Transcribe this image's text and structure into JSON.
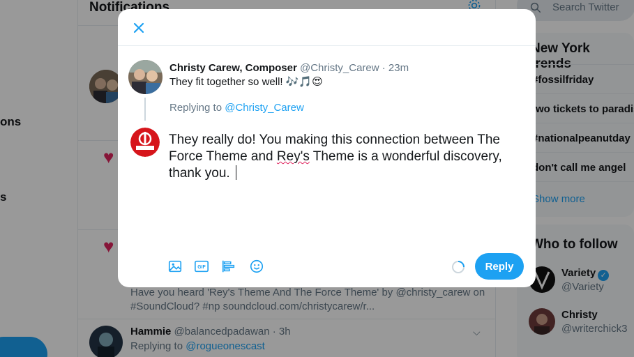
{
  "background": {
    "left_nav": {
      "items": [
        "ons",
        "s"
      ]
    },
    "center": {
      "title": "Notifications",
      "snippet_line1": "Have you heard 'Rey's Theme And The Force Theme' by @christy_carew on",
      "snippet_line2": "#SoundCloud? #np soundcloud.com/christycarew/r...",
      "tweet": {
        "name": "Hammie",
        "handle": "@balancedpadawan",
        "time": "· 3h",
        "replying_prefix": "Replying to",
        "replying_to": "@rogueonescast"
      }
    },
    "right": {
      "search_placeholder": "Search Twitter",
      "trends_title": "New York trends",
      "trends": [
        "#fossilfriday",
        "two tickets to paradise",
        "#nationalpeanutday",
        "don't call me angel"
      ],
      "show_more": "Show more",
      "wtf_title": "Who to follow",
      "follow": [
        {
          "name": "Variety",
          "handle": "@Variety",
          "verified": true
        },
        {
          "name": "Christy",
          "handle": "@writerchick3",
          "verified": false
        }
      ]
    }
  },
  "modal": {
    "original": {
      "name": "Christy Carew, Composer",
      "handle": "@Christy_Carew",
      "time": "· 23m",
      "text": "They fit together so well! 🎶🎵😍"
    },
    "replying_prefix": "Replying to",
    "replying_to": "@Christy_Carew",
    "avatar_label": "ROGUE ONES",
    "compose": {
      "before": "They really do! You making this connection between The Force Theme and ",
      "misspelled": "Rey's",
      "after": " Theme is a wonderful discovery, thank you. "
    },
    "reply_button": "Reply",
    "toolbar": [
      "image-icon",
      "gif-icon",
      "poll-icon",
      "emoji-icon"
    ],
    "colors": {
      "accent": "#1da1f2",
      "heart": "#e0245e"
    }
  }
}
